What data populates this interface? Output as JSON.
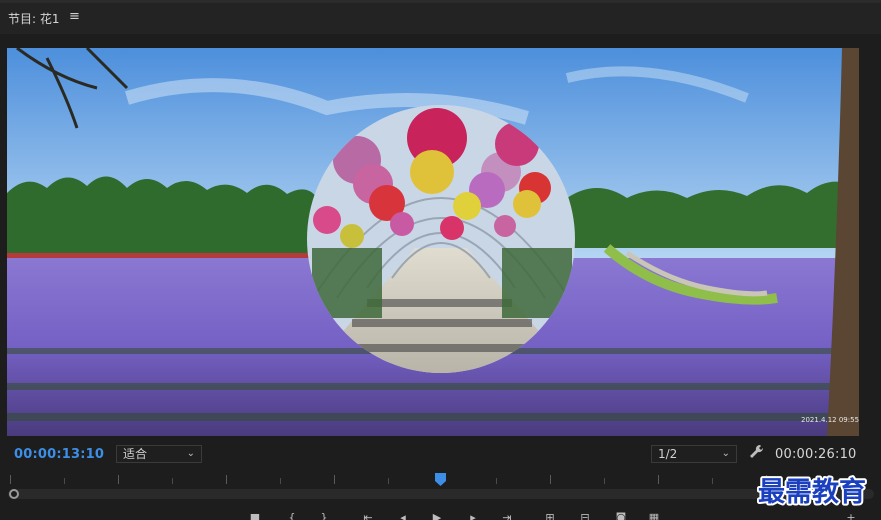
{
  "panel": {
    "title": "节目: 花1",
    "menu_icon": "hamburger-menu-icon"
  },
  "video": {
    "overlay_timestamp": "2021.4.12 09:55"
  },
  "controls": {
    "current_timecode": "00:00:13:10",
    "fit_value": "适合",
    "resolution_value": "1/2",
    "total_timecode": "00:00:26:10",
    "settings_icon": "wrench-icon"
  },
  "transport": {
    "icons": [
      "stop-icon",
      "mark-in-icon",
      "mark-out-icon",
      "go-to-in-icon",
      "step-back-icon",
      "play-icon",
      "step-forward-icon",
      "go-to-out-icon",
      "lift-icon",
      "extract-icon",
      "export-frame-icon",
      "comparison-view-icon",
      "add-button-icon"
    ]
  },
  "watermark": {
    "text": "最需教育"
  },
  "colors": {
    "accent_timecode": "#3d8ee6",
    "playhead": "#3d8ee6",
    "watermark": "#1a3fbf"
  }
}
